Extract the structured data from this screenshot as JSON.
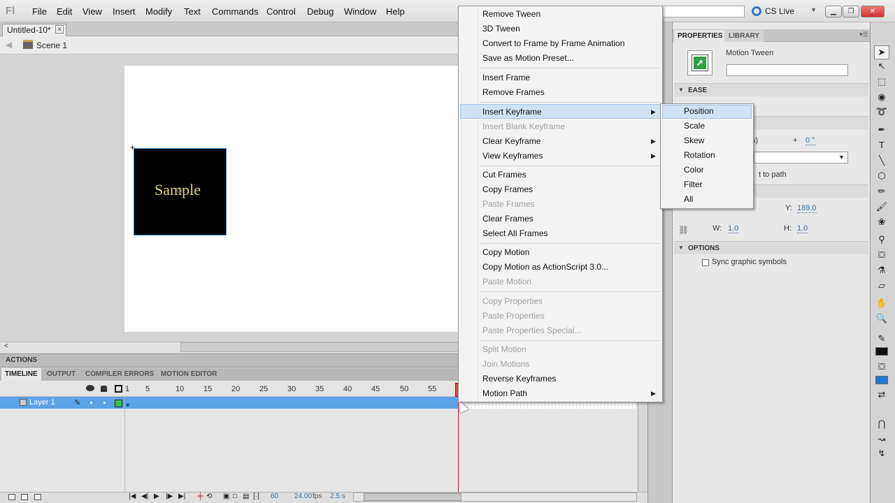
{
  "menubar": {
    "logo": "Fl",
    "items": [
      "File",
      "Edit",
      "View",
      "Insert",
      "Modify",
      "Text",
      "Commands",
      "Control",
      "Debug",
      "Window",
      "Help"
    ],
    "cslive": "CS Live"
  },
  "document": {
    "tab_title": "Untitled-10*",
    "scene": "Scene 1",
    "symbol_text": "Sample"
  },
  "panels": {
    "actions": "ACTIONS",
    "timeline_tabs": [
      "TIMELINE",
      "OUTPUT",
      "COMPILER ERRORS",
      "MOTION EDITOR"
    ]
  },
  "timeline": {
    "frame_numbers": [
      "1",
      "5",
      "10",
      "15",
      "20",
      "25",
      "30",
      "35",
      "40",
      "45",
      "50",
      "55"
    ],
    "layer_name": "Layer 1",
    "current_frame": "60",
    "fps": "24.00",
    "fps_unit": "fps",
    "elapsed": "2.5 s"
  },
  "context_menu": {
    "items": [
      {
        "label": "Remove Tween"
      },
      {
        "label": "3D Tween"
      },
      {
        "label": "Convert to Frame by Frame Animation"
      },
      {
        "label": "Save as Motion Preset..."
      },
      {
        "label": "Insert Frame"
      },
      {
        "label": "Remove Frames"
      },
      {
        "label": "Insert Keyframe"
      },
      {
        "label": "Insert Blank Keyframe"
      },
      {
        "label": "Clear Keyframe"
      },
      {
        "label": "View Keyframes"
      },
      {
        "label": "Cut Frames"
      },
      {
        "label": "Copy Frames"
      },
      {
        "label": "Paste Frames"
      },
      {
        "label": "Clear Frames"
      },
      {
        "label": "Select All Frames"
      },
      {
        "label": "Copy Motion"
      },
      {
        "label": "Copy Motion as ActionScript 3.0..."
      },
      {
        "label": "Paste Motion"
      },
      {
        "label": "Copy Properties"
      },
      {
        "label": "Paste Properties"
      },
      {
        "label": "Paste Properties Special..."
      },
      {
        "label": "Split Motion"
      },
      {
        "label": "Join Motions"
      },
      {
        "label": "Reverse Keyframes"
      },
      {
        "label": "Motion Path"
      }
    ]
  },
  "submenu": {
    "items": [
      "Position",
      "Scale",
      "Skew",
      "Rotation",
      "Color",
      "Filter",
      "All"
    ]
  },
  "properties": {
    "tabs": [
      "PROPERTIES",
      "LIBRARY"
    ],
    "type_label": "Motion Tween",
    "ease_header": "EASE",
    "rotate_prefix": "s)",
    "plus_sign": "+",
    "degrees": "0 °",
    "orient_label": "t to path",
    "y_label": "Y:",
    "y_value": "189.0",
    "w_label": "W:",
    "w_value": "1.0",
    "h_label": "H:",
    "h_value": "1.0",
    "options_header": "OPTIONS",
    "sync_label": "Sync graphic symbols"
  }
}
